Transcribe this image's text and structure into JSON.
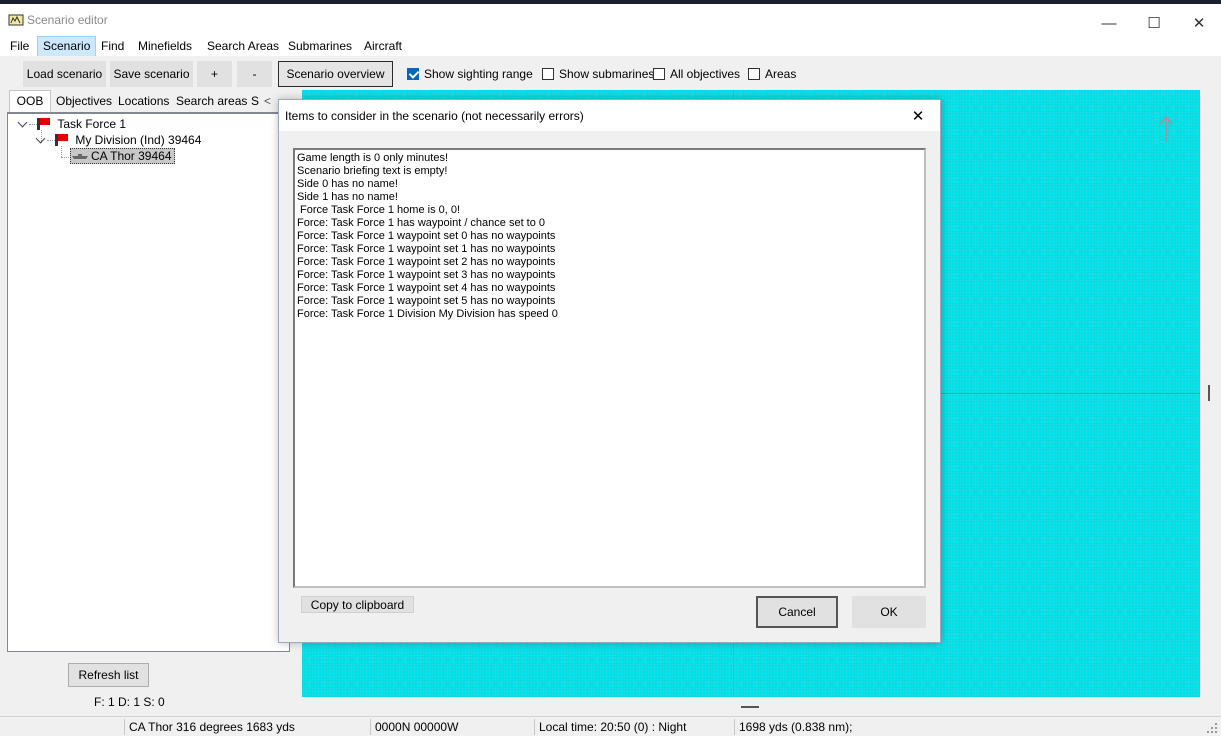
{
  "window": {
    "title": "Scenario editor"
  },
  "menu": {
    "items": [
      "File",
      "Scenario",
      "Find",
      "Minefields",
      "Search Areas",
      "Submarines",
      "Aircraft"
    ],
    "active": "Scenario"
  },
  "toolbar": {
    "load_label": "Load scenario",
    "save_label": "Save scenario",
    "plus_label": "+",
    "minus_label": "-",
    "overview_label": "Scenario overview",
    "checkboxes": [
      {
        "label": "Show sighting range",
        "checked": true
      },
      {
        "label": "Show submarines",
        "checked": false
      },
      {
        "label": "All objectives",
        "checked": false
      },
      {
        "label": "Areas",
        "checked": false
      }
    ]
  },
  "left_panel": {
    "tabs": [
      "OOB",
      "Objectives",
      "Locations",
      "Search areas",
      "S"
    ],
    "tab_scroll": "<",
    "tree": {
      "force": "Task Force 1",
      "division": "My Division (Ind) 39464",
      "ship": "CA Thor 39464"
    },
    "refresh_label": "Refresh list",
    "counts": "F: 1 D: 1 S: 0"
  },
  "dialog": {
    "title": "Items to consider in the scenario (not necessarily errors)",
    "close_glyph": "✕",
    "lines": [
      "Game length is 0 only minutes!",
      "Scenario briefing text is empty!",
      "Side 0 has no name!",
      "Side 1 has no name!",
      " Force Task Force 1 home is 0, 0!",
      "Force: Task Force 1 has waypoint / chance set to 0",
      "Force: Task Force 1 waypoint set 0 has no waypoints",
      "Force: Task Force 1 waypoint set 1 has no waypoints",
      "Force: Task Force 1 waypoint set 2 has no waypoints",
      "Force: Task Force 1 waypoint set 3 has no waypoints",
      "Force: Task Force 1 waypoint set 4 has no waypoints",
      "Force: Task Force 1 waypoint set 5 has no waypoints",
      "Force: Task Force 1 Division My Division has speed 0"
    ],
    "copy_label": "Copy to clipboard",
    "cancel_label": "Cancel",
    "ok_label": "OK"
  },
  "status": {
    "ship_info": "CA Thor 316 degrees 1683 yds",
    "position": "0000N 00000W",
    "local_time": "Local time: 20:50 (0) : Night",
    "range": "1698 yds (0.838 nm);"
  },
  "colors": {
    "map_water": "#00e0e6",
    "selection": "#cce8ff",
    "flag": "#e00000",
    "check_accent": "#0067c0"
  },
  "icons": {
    "app": "app-icon",
    "flag": "flag-icon",
    "ship": "ship-icon",
    "north_arrow": "north-arrow-icon"
  }
}
